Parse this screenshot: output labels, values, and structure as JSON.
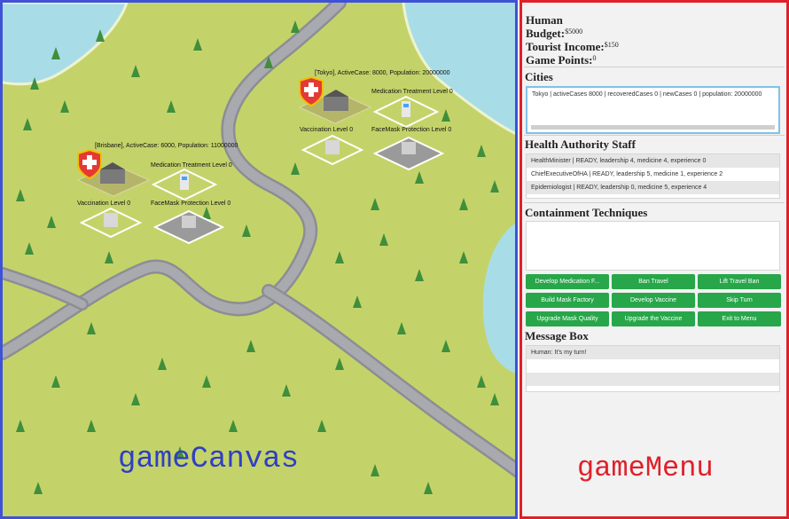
{
  "canvas": {
    "caption": "gameCanvas",
    "cities": [
      {
        "info": "[Brisbane], ActiveCase: 6000, Population: 11000000",
        "medication": "Medication Treatment Level 0",
        "vaccination": "Vaccination Level 0",
        "facemask": "FaceMask Protection Level 0"
      },
      {
        "info": "[Tokyo], ActiveCase: 8000, Population: 20000000",
        "medication": "Medication Treatment Level 0",
        "vaccination": "Vaccination Level 0",
        "facemask": "FaceMask Protection Level 0"
      }
    ]
  },
  "menu": {
    "caption": "gameMenu",
    "player": "Human",
    "budget_label": "Budget:",
    "budget_value": "$5000",
    "tourist_label": "Tourist Income:",
    "tourist_value": "$150",
    "points_label": "Game Points:",
    "points_value": "0",
    "cities_title": "Cities",
    "cities": [
      "Tokyo | activeCases 8000 | recoveredCases 0 | newCases 0 | population: 20000000"
    ],
    "staff_title": "Health Authority Staff",
    "staff": [
      "HealthMinister | READY, leadership 4, medicine 4, experience 0",
      "ChiefExecutiveOfHA | READY, leadership 5, medicine 1, experience 2",
      "Epidemiologist | READY, leadership 0, medicine 5, experience 4"
    ],
    "containment_title": "Containment Techniques",
    "buttons": [
      "Develop Medication F...",
      "Ban Travel",
      "Lift Travel Ban",
      "Build Mask Factory",
      "Develop Vaccine",
      "Skip Turn",
      "Upgrade Mask Quality",
      "Upgrade the Vaccine",
      "Exit to Menu"
    ],
    "message_title": "Message Box",
    "messages": [
      "Human:    It's my turn!"
    ]
  },
  "colors": {
    "canvas_border": "#3f51d6",
    "menu_border": "#e0202a",
    "button": "#27a64a",
    "grass": "#c4d369",
    "water": "#a8dde8",
    "road": "#9c9ca4"
  }
}
